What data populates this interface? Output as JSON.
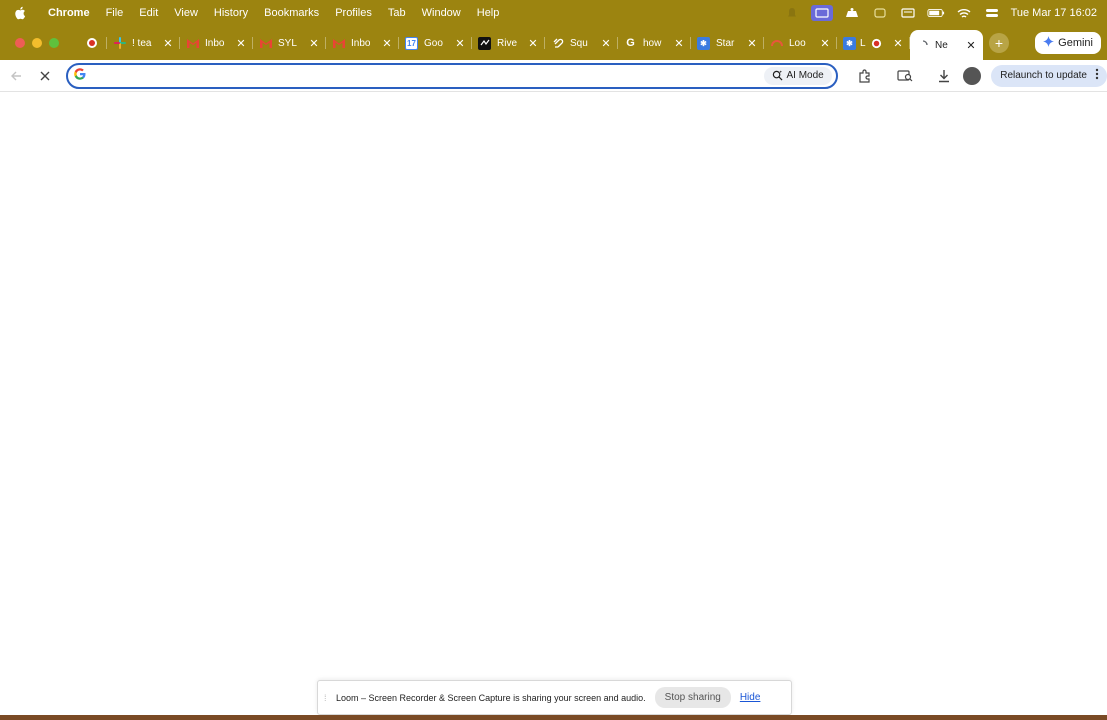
{
  "menubar": {
    "app_name": "Chrome",
    "items": [
      "File",
      "Edit",
      "View",
      "History",
      "Bookmarks",
      "Profiles",
      "Tab",
      "Window",
      "Help"
    ],
    "clock": "Tue Mar 17  16:02"
  },
  "tabs": [
    {
      "title": "! tea",
      "icon": "slack-icon"
    },
    {
      "title": "Inbo",
      "icon": "gmail-icon"
    },
    {
      "title": "SYL",
      "icon": "gmail-icon"
    },
    {
      "title": "Inbo",
      "icon": "gmail-icon"
    },
    {
      "title": "Goo",
      "icon": "google-calendar-icon"
    },
    {
      "title": "Rive",
      "icon": "rive-icon"
    },
    {
      "title": "Squ",
      "icon": "squarespace-icon"
    },
    {
      "title": "how",
      "icon": "google-icon"
    },
    {
      "title": "Star",
      "icon": "star-icon"
    },
    {
      "title": "Loo",
      "icon": "loom-icon"
    },
    {
      "title": "L",
      "icon": "recording-icon"
    },
    {
      "title": "Ne",
      "icon": "loading-icon",
      "active": true
    }
  ],
  "gemini_label": "Gemini",
  "toolbar": {
    "search_value": "",
    "ai_mode_label": "AI Mode",
    "relaunch_label": "Relaunch to update"
  },
  "loom": {
    "message": "Loom – Screen Recorder & Screen Capture is sharing your screen and audio.",
    "stop_label": "Stop sharing",
    "hide_label": "Hide"
  },
  "colors": {
    "menubar_bg": "#9c8410",
    "omnibox_border": "#2a5fc0",
    "relaunch_bg": "#dbe5f7"
  }
}
